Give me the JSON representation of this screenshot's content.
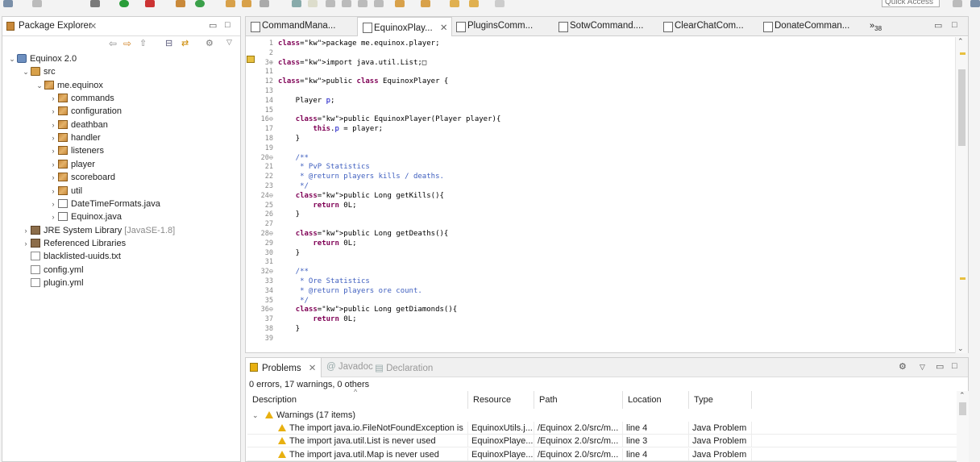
{
  "toolbar": {
    "quick_access": "Quick Access"
  },
  "package_explorer": {
    "title": "Package Explorer",
    "tree": [
      {
        "label": "Equinox 2.0",
        "indent": 0,
        "icon": "project",
        "expanded": true
      },
      {
        "label": "src",
        "indent": 1,
        "icon": "src-folder",
        "expanded": true
      },
      {
        "label": "me.equinox",
        "indent": 2,
        "icon": "package",
        "expanded": true
      },
      {
        "label": "commands",
        "indent": 3,
        "icon": "package"
      },
      {
        "label": "configuration",
        "indent": 3,
        "icon": "package"
      },
      {
        "label": "deathban",
        "indent": 3,
        "icon": "package"
      },
      {
        "label": "handler",
        "indent": 3,
        "icon": "package"
      },
      {
        "label": "listeners",
        "indent": 3,
        "icon": "package"
      },
      {
        "label": "player",
        "indent": 3,
        "icon": "package"
      },
      {
        "label": "scoreboard",
        "indent": 3,
        "icon": "package"
      },
      {
        "label": "util",
        "indent": 3,
        "icon": "package"
      },
      {
        "label": "DateTimeFormats.java",
        "indent": 3,
        "icon": "java-file"
      },
      {
        "label": "Equinox.java",
        "indent": 3,
        "icon": "java-file"
      },
      {
        "label": "JRE System Library",
        "suffix": "[JavaSE-1.8]",
        "indent": 1,
        "icon": "library"
      },
      {
        "label": "Referenced Libraries",
        "indent": 1,
        "icon": "library"
      },
      {
        "label": "blacklisted-uuids.txt",
        "indent": 1,
        "icon": "file"
      },
      {
        "label": "config.yml",
        "indent": 1,
        "icon": "file"
      },
      {
        "label": "plugin.yml",
        "indent": 1,
        "icon": "file"
      }
    ]
  },
  "editor": {
    "tabs": [
      "CommandMana...",
      "EquinoxPlay...",
      "PluginsComm...",
      "SotwCommand....",
      "ClearChatCom...",
      "DonateComman..."
    ],
    "active_tab": 1,
    "overflow_count": "38",
    "lines": [
      {
        "n": "1",
        "t": "package me.equinox.player;"
      },
      {
        "n": "2",
        "t": ""
      },
      {
        "n": "3⊕",
        "t": "import java.util.List;□"
      },
      {
        "n": "11",
        "t": ""
      },
      {
        "n": "12",
        "t": "public class EquinoxPlayer {"
      },
      {
        "n": "13",
        "t": ""
      },
      {
        "n": "14",
        "t": "    Player p;"
      },
      {
        "n": "15",
        "t": ""
      },
      {
        "n": "16⊖",
        "t": "    public EquinoxPlayer(Player player){"
      },
      {
        "n": "17",
        "t": "        this.p = player;"
      },
      {
        "n": "18",
        "t": "    }"
      },
      {
        "n": "19",
        "t": ""
      },
      {
        "n": "20⊖",
        "t": "    /**"
      },
      {
        "n": "21",
        "t": "     * PvP Statistics"
      },
      {
        "n": "22",
        "t": "     * @return players kills / deaths."
      },
      {
        "n": "23",
        "t": "     */"
      },
      {
        "n": "24⊖",
        "t": "    public Long getKills(){"
      },
      {
        "n": "25",
        "t": "        return 0L;"
      },
      {
        "n": "26",
        "t": "    }"
      },
      {
        "n": "27",
        "t": ""
      },
      {
        "n": "28⊖",
        "t": "    public Long getDeaths(){"
      },
      {
        "n": "29",
        "t": "        return 0L;"
      },
      {
        "n": "30",
        "t": "    }"
      },
      {
        "n": "31",
        "t": ""
      },
      {
        "n": "32⊖",
        "t": "    /**"
      },
      {
        "n": "33",
        "t": "     * Ore Statistics"
      },
      {
        "n": "34",
        "t": "     * @return players ore count."
      },
      {
        "n": "35",
        "t": "     */"
      },
      {
        "n": "36⊖",
        "t": "    public Long getDiamonds(){"
      },
      {
        "n": "37",
        "t": "        return 0L;"
      },
      {
        "n": "38",
        "t": "    }"
      },
      {
        "n": "39",
        "t": ""
      }
    ]
  },
  "problems": {
    "tabs": [
      "Problems",
      "Javadoc",
      "Declaration"
    ],
    "summary": "0 errors, 17 warnings, 0 others",
    "columns": [
      "Description",
      "Resource",
      "Path",
      "Location",
      "Type"
    ],
    "group": "Warnings (17 items)",
    "rows": [
      {
        "description": "The import java.io.FileNotFoundException is",
        "resource": "EquinoxUtils.j...",
        "path": "/Equinox 2.0/src/m...",
        "location": "line 4",
        "type": "Java Problem"
      },
      {
        "description": "The import java.util.List is never used",
        "resource": "EquinoxPlaye...",
        "path": "/Equinox 2.0/src/m...",
        "location": "line 3",
        "type": "Java Problem"
      },
      {
        "description": "The import java.util.Map is never used",
        "resource": "EquinoxPlaye...",
        "path": "/Equinox 2.0/src/m...",
        "location": "line 4",
        "type": "Java Problem"
      }
    ]
  },
  "colors": {
    "keyword": "#7f0055",
    "comment": "#3f5fbf",
    "field": "#0000c0",
    "warning": "#e8b010"
  }
}
